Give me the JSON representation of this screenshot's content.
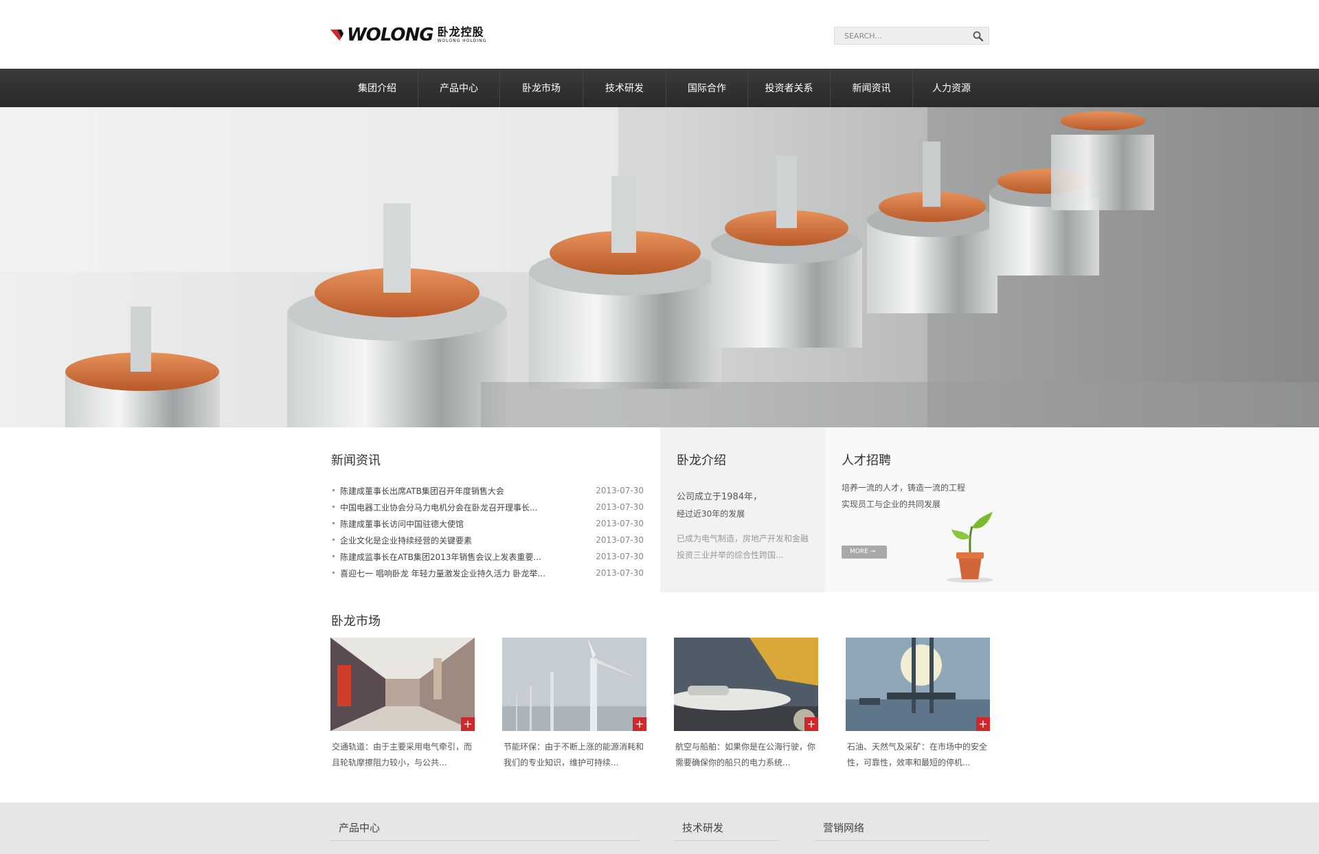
{
  "header": {
    "logo_text": "WOLONG",
    "logo_cn": "卧龙控股",
    "logo_en": "WOLONG HOLDING",
    "search_placeholder": "SEARCH..."
  },
  "nav": {
    "items": [
      "集团介绍",
      "产品中心",
      "卧龙市场",
      "技术研发",
      "国际合作",
      "投资者关系",
      "新闻资讯",
      "人力资源"
    ]
  },
  "news": {
    "title": "新闻资讯",
    "items": [
      {
        "text": "陈建成董事长出席ATB集团召开年度销售大会",
        "date": "2013-07-30"
      },
      {
        "text": "中国电器工业协会分马力电机分会在卧龙召开理事长...",
        "date": "2013-07-30"
      },
      {
        "text": "陈建成董事长访问中国驻德大使馆",
        "date": "2013-07-30"
      },
      {
        "text": "企业文化是企业持续经营的关键要素",
        "date": "2013-07-30"
      },
      {
        "text": "陈建成监事长在ATB集团2013年销售会议上发表重要...",
        "date": "2013-07-30"
      },
      {
        "text": "喜迎七一 唱响卧龙 年轻力量激发企业持久活力 卧龙举...",
        "date": "2013-07-30"
      }
    ]
  },
  "about": {
    "title": "卧龙介绍",
    "line1": "公司成立于1984年，",
    "line2": "经过近30年的发展",
    "line3": "已成为电气制造，房地产开发和金融",
    "line4": "投资三业并举的综合性跨国..."
  },
  "recruit": {
    "title": "人才招聘",
    "line1": "培养一流的人才，铸造一流的工程",
    "line2": "实现员工与企业的共同发展",
    "more_label": "MORE →"
  },
  "market": {
    "title": "卧龙市场",
    "cards": [
      {
        "line1": "交通轨道：由于主要采用电气牵引，而",
        "line2": "且轮轨摩擦阻力较小，与公共..."
      },
      {
        "line1": "节能环保：由于不断上涨的能源消耗和",
        "line2": "我们的专业知识，维护可持续..."
      },
      {
        "line1": "航空与船舶：如果你是在公海行驶，你",
        "line2": "需要确保你的船只的电力系统..."
      },
      {
        "line1": "石油、天然气及采矿：在市场中的安全",
        "line2": "性，可靠性，效率和最短的停机..."
      }
    ],
    "plus": "+"
  },
  "footer": {
    "col1": "产品中心",
    "col2": "技术研发",
    "col3": "营销网络"
  },
  "colors": {
    "accent": "#d0282a",
    "nav_bg": "#2f2f2f"
  }
}
